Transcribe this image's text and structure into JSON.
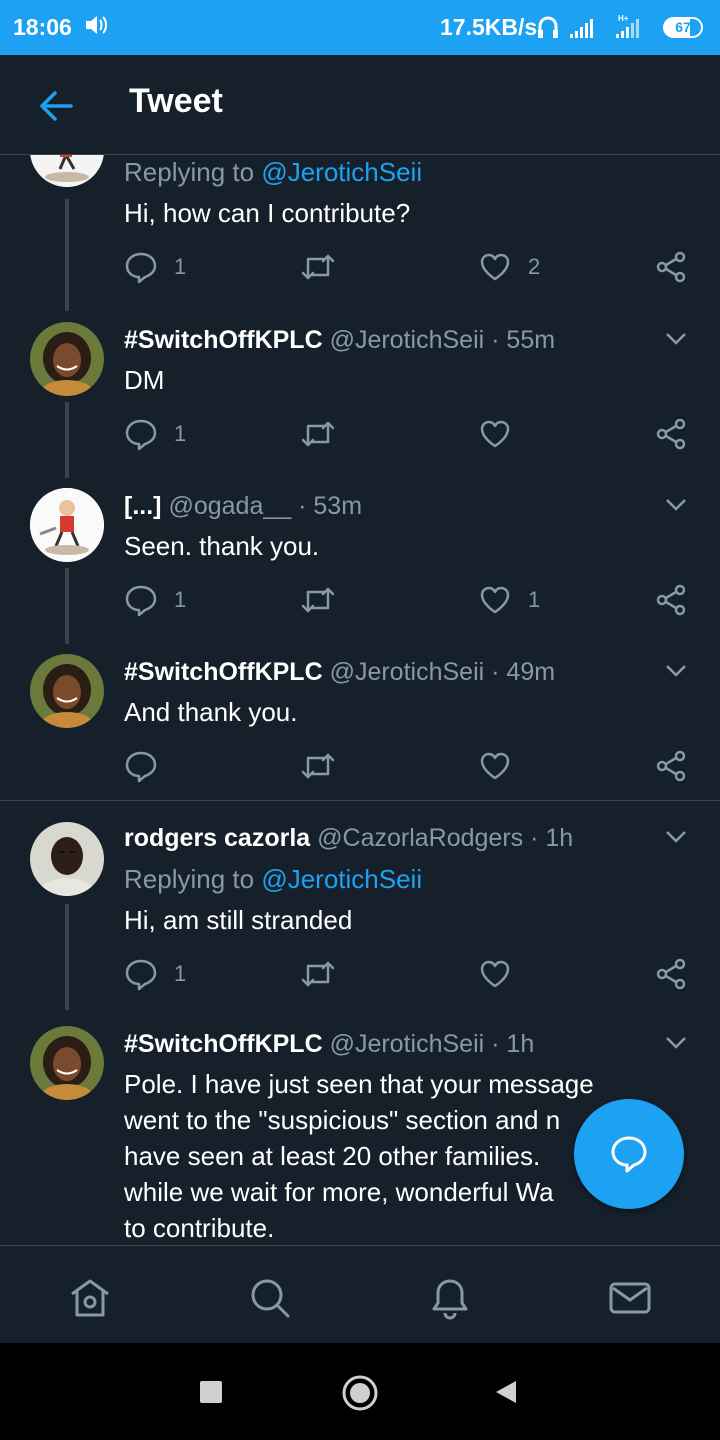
{
  "status_bar": {
    "time": "18:06",
    "network_speed": "17.5KB/s",
    "signal_label": "H+",
    "battery": "67"
  },
  "header": {
    "title": "Tweet"
  },
  "tweets": [
    {
      "replying_prefix": "Replying to",
      "replying_to": "@JerotichSeii",
      "text": "Hi, how can I contribute?",
      "reply_count": "1",
      "like_count": "2"
    },
    {
      "name": "#SwitchOffKPLC",
      "handle": "@JerotichSeii",
      "time": "· 55m",
      "text": "DM",
      "reply_count": "1",
      "like_count": ""
    },
    {
      "name": "[...]",
      "handle": "@ogada__",
      "time": "· 53m",
      "text": "Seen. thank you.",
      "reply_count": "1",
      "like_count": "1"
    },
    {
      "name": "#SwitchOffKPLC",
      "handle": "@JerotichSeii",
      "time": "· 49m",
      "text": "And thank you.",
      "reply_count": "",
      "like_count": ""
    },
    {
      "name": "rodgers cazorla",
      "handle": "@CazorlaRodgers",
      "time": "· 1h",
      "replying_prefix": "Replying to",
      "replying_to": "@JerotichSeii",
      "text": "Hi, am still stranded",
      "reply_count": "1",
      "like_count": ""
    },
    {
      "name": "#SwitchOffKPLC",
      "handle": "@JerotichSeii",
      "time": "· 1h",
      "text_lines": [
        "Pole. I have just seen that your message",
        "went to the \"suspicious\" section and n",
        "have seen at least 20 other families.",
        "while we wait for more, wonderful Wa",
        "to contribute."
      ]
    }
  ],
  "bottom_nav": [
    "home-icon",
    "search-icon",
    "notifications-icon",
    "messages-icon"
  ],
  "colors": {
    "background": "#15202b",
    "accent": "#1da1f2",
    "secondary_text": "#8899a6",
    "divider": "#38444d"
  }
}
